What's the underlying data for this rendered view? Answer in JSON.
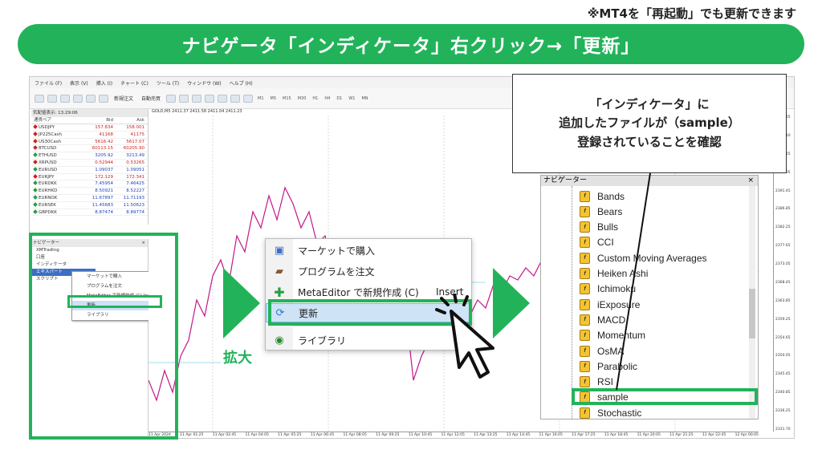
{
  "top_note": "※MT4を「再起動」でも更新できます",
  "banner": "ナビゲータ「インディケータ」右クリック→「更新」",
  "callout": {
    "line1": "「インディケータ」に",
    "line2": "追加したファイルが（sample）",
    "line3": "登録されていることを確認"
  },
  "zoom_label": "拡大",
  "mt4": {
    "menu": [
      "ファイル (F)",
      "表示 (V)",
      "挿入 (I)",
      "チャート (C)",
      "ツール (T)",
      "ウィンドウ (W)",
      "ヘルプ (H)"
    ],
    "toolbar": {
      "new_order": "新規注文",
      "auto_trade": "自動売買",
      "timeframes": [
        "M1",
        "M5",
        "M15",
        "M30",
        "H1",
        "H4",
        "D1",
        "W1",
        "MN"
      ]
    },
    "market_watch": {
      "title": "気配値表示: 13:29:06",
      "headers": [
        "通貨ペア",
        "Bid",
        "Ask"
      ],
      "rows": [
        {
          "sym": "USDJPY",
          "bid": "157.834",
          "ask": "158.001",
          "dir": "dn"
        },
        {
          "sym": "JP225Cash",
          "bid": "41168",
          "ask": "41175",
          "dir": "dn"
        },
        {
          "sym": "US30Cash",
          "bid": "5616.42",
          "ask": "5617.07",
          "dir": "dn"
        },
        {
          "sym": "BTCUSD",
          "bid": "60113.15",
          "ask": "60205.90",
          "dir": "dn"
        },
        {
          "sym": "ETHUSD",
          "bid": "3205.92",
          "ask": "3213.49",
          "dir": "up"
        },
        {
          "sym": "XRPUSD",
          "bid": "0.52944",
          "ask": "0.53265",
          "dir": "dn"
        },
        {
          "sym": "EURUSD",
          "bid": "1.09037",
          "ask": "1.09051",
          "dir": "up"
        },
        {
          "sym": "EURJPY",
          "bid": "172.129",
          "ask": "172.341",
          "dir": "dn"
        },
        {
          "sym": "EURDKK",
          "bid": "7.45954",
          "ask": "7.46425",
          "dir": "up"
        },
        {
          "sym": "EURHKD",
          "bid": "8.50921",
          "ask": "8.52227",
          "dir": "up"
        },
        {
          "sym": "EURNOK",
          "bid": "11.67897",
          "ask": "11.71193",
          "dir": "up"
        },
        {
          "sym": "EURSEK",
          "bid": "11.45683",
          "ask": "11.50623",
          "dir": "up"
        },
        {
          "sym": "GBPDKK",
          "bid": "8.87474",
          "ask": "8.89774",
          "dir": "up"
        }
      ]
    },
    "navigator_small": {
      "title": "ナビゲーター",
      "items": [
        "XMTrading",
        "口座",
        "インディケータ",
        "エキスパート",
        "スクリプト"
      ],
      "context": [
        "マーケットで購入",
        "プログラムを注文",
        "MetaEditor で新規作成 (C)   Insert",
        "更新",
        "ライブラリ"
      ]
    },
    "chart": {
      "header": "GOLD,M5  2411.37 2411.58 2411.04 2411.23",
      "x_ticks": [
        "11 Apr 2024",
        "11 Apr 01:25",
        "11 Apr 02:45",
        "11 Apr 04:05",
        "11 Apr 05:25",
        "11 Apr 06:45",
        "11 Apr 08:05",
        "11 Apr 09:25",
        "11 Apr 10:45",
        "11 Apr 12:05",
        "11 Apr 13:25",
        "11 Apr 14:45",
        "11 Apr 16:05",
        "11 Apr 17:25",
        "11 Apr 18:45",
        "11 Apr 20:05",
        "11 Apr 21:25",
        "11 Apr 22:45",
        "12 Apr 00:05"
      ],
      "y_ticks": [
        "2411.25",
        "2406.10",
        "2400.25",
        "2396.05",
        "2391.45",
        "2386.85",
        "2382.25",
        "2377.65",
        "2373.05",
        "2368.45",
        "2363.85",
        "2359.25",
        "2354.65",
        "2350.05",
        "2345.45",
        "2340.85",
        "2336.25",
        "2331.70"
      ]
    }
  },
  "context_big": {
    "items": [
      {
        "label": "マーケットで購入",
        "icon": "cart-icon"
      },
      {
        "label": "プログラムを注文",
        "icon": "briefcase-icon"
      },
      {
        "label": "MetaEditor で新規作成 (C)",
        "shortcut": "Insert",
        "icon": "plus-icon"
      },
      {
        "label": "更新",
        "icon": "refresh-icon"
      },
      {
        "label": "ライブラリ",
        "icon": "globe-icon"
      }
    ]
  },
  "navigator_big": {
    "title": "ナビゲーター",
    "close": "×",
    "items": [
      "Bands",
      "Bears",
      "Bulls",
      "CCI",
      "Custom Moving Averages",
      "Heiken Ashi",
      "Ichimoku",
      "iExposure",
      "MACD",
      "Momentum",
      "OsMA",
      "Parabolic",
      "RSI",
      "sample",
      "Stochastic"
    ]
  }
}
